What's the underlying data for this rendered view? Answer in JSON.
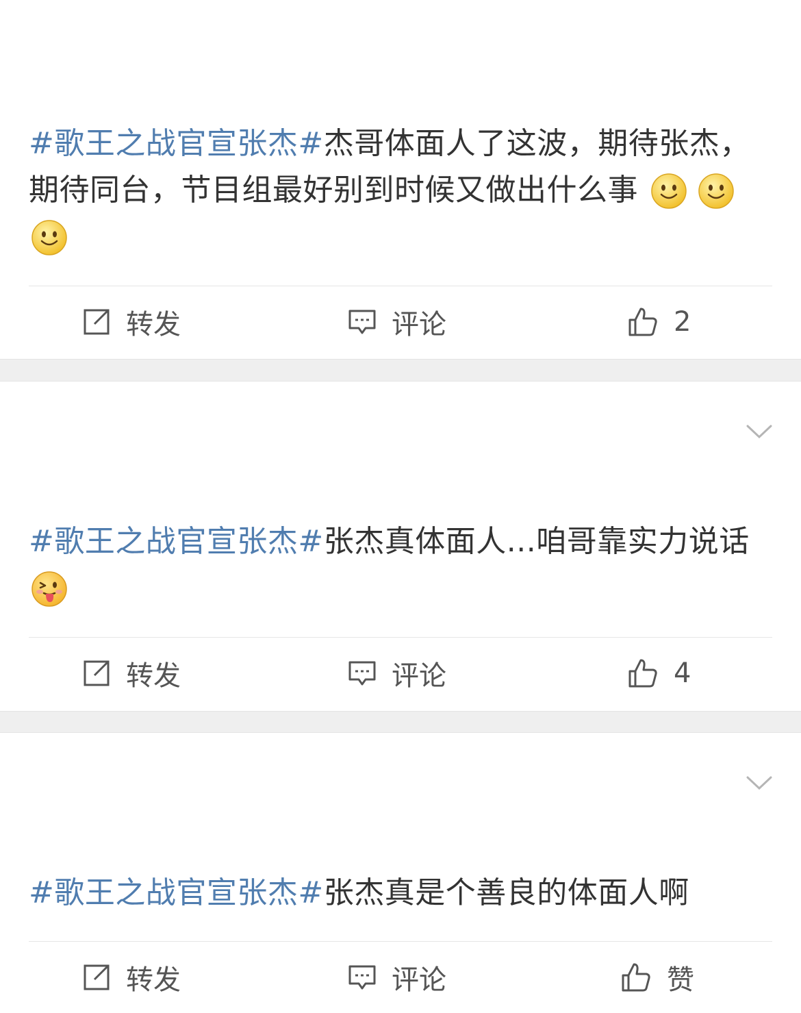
{
  "posts": [
    {
      "topic": "#歌王之战官宣张杰#",
      "text": "杰哥体面人了这波，期待张杰，期待同台，节目组最好别到时候又做出什么事",
      "emojis": [
        "smile-emoji",
        "smile-emoji",
        "smile-emoji"
      ],
      "actions": {
        "repost": "转发",
        "comment": "评论",
        "like": "2"
      }
    },
    {
      "topic": "#歌王之战官宣张杰#",
      "text": "张杰真体面人...咱哥靠实力说话",
      "emojis": [
        "tongue-wink-emoji"
      ],
      "actions": {
        "repost": "转发",
        "comment": "评论",
        "like": "4"
      }
    },
    {
      "topic": "#歌王之战官宣张杰#",
      "text": "张杰真是个善良的体面人啊",
      "emojis": [],
      "actions": {
        "repost": "转发",
        "comment": "评论",
        "like": "赞"
      }
    }
  ],
  "colors": {
    "topic": "#507daf",
    "text": "#333333",
    "separator": "#efefef"
  }
}
